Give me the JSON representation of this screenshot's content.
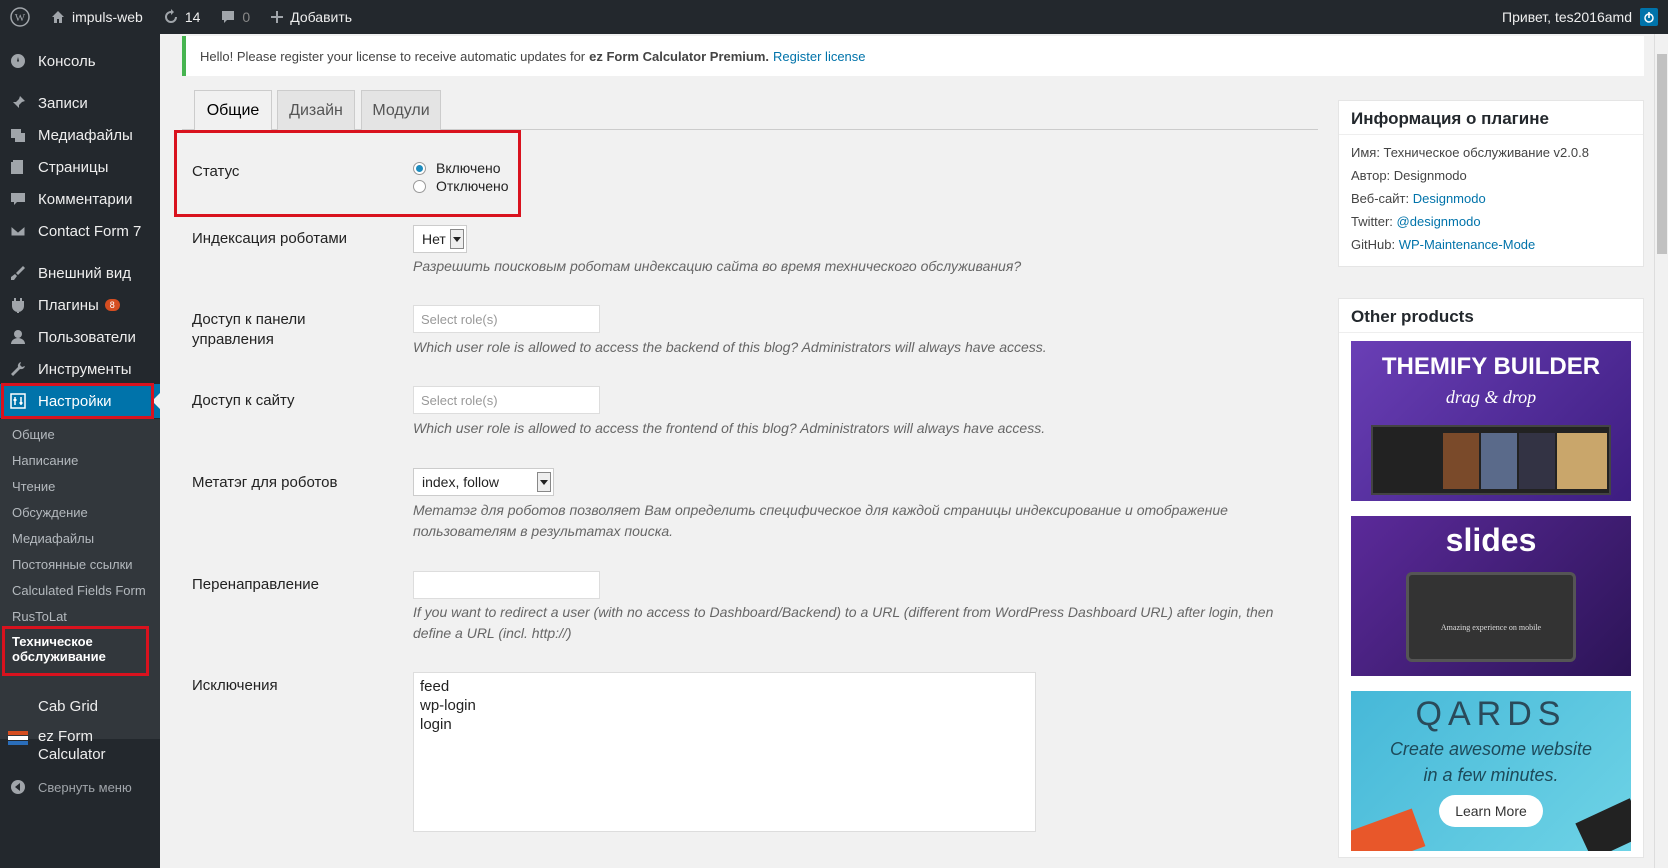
{
  "adminbar": {
    "site_name": "impuls-web",
    "updates_count": "14",
    "comments_count": "0",
    "add_new": "Добавить",
    "greeting": "Привет, tes2016amd"
  },
  "sidebar": {
    "items": [
      {
        "label": "Консоль",
        "icon": "dashboard-icon"
      },
      {
        "label": "Записи",
        "icon": "pin-icon"
      },
      {
        "label": "Медиафайлы",
        "icon": "media-icon"
      },
      {
        "label": "Страницы",
        "icon": "page-icon"
      },
      {
        "label": "Комментарии",
        "icon": "comment-icon"
      },
      {
        "label": "Contact Form 7",
        "icon": "mail-icon"
      },
      {
        "label": "Внешний вид",
        "icon": "brush-icon"
      },
      {
        "label": "Плагины",
        "icon": "plugin-icon",
        "badge": "8"
      },
      {
        "label": "Пользователи",
        "icon": "user-icon"
      },
      {
        "label": "Инструменты",
        "icon": "wrench-icon"
      },
      {
        "label": "Настройки",
        "icon": "settings-icon"
      }
    ],
    "submenu": [
      "Общие",
      "Написание",
      "Чтение",
      "Обсуждение",
      "Медиафайлы",
      "Постоянные ссылки",
      "Calculated Fields Form",
      "RusToLat"
    ],
    "submenu_current_line1": "Техническое",
    "submenu_current_line2": "обслуживание",
    "cab_grid": "Cab Grid",
    "ez_form_line1": "ez Form",
    "ez_form_line2": "Calculator",
    "collapse": "Свернуть меню"
  },
  "notice": {
    "text": "Hello! Please register your license to receive automatic updates for",
    "product": "ez Form Calculator Premium.",
    "link": "Register license"
  },
  "tabs": [
    "Общие",
    "Дизайн",
    "Модули"
  ],
  "form": {
    "status_label": "Статус",
    "status_on": "Включено",
    "status_off": "Отключено",
    "indexing_label": "Индексация роботами",
    "indexing_value": "Нет",
    "indexing_desc": "Разрешить поисковым роботам индексацию сайта во время технического обслуживания?",
    "backend_label_1": "Доступ к панели",
    "backend_label_2": "управления",
    "backend_placeholder": "Select role(s)",
    "backend_desc": "Which user role is allowed to access the backend of this blog? Administrators will always have access.",
    "frontend_label": "Доступ к сайту",
    "frontend_placeholder": "Select role(s)",
    "frontend_desc": "Which user role is allowed to access the frontend of this blog? Administrators will always have access.",
    "meta_label": "Метатэг для роботов",
    "meta_value": "index, follow",
    "meta_desc_1": "Метатэг для роботов позволяет Вам определить специфическое для каждой страницы индексирование и отображение",
    "meta_desc_2": "пользователям в результатах поиска.",
    "redirect_label": "Перенаправление",
    "redirect_desc_1": "If you want to redirect a user (with no access to Dashboard/Backend) to a URL (different from WordPress Dashboard URL) after login, then",
    "redirect_desc_2": "define a URL (incl. http://)",
    "exclusions_label": "Исключения",
    "exclusions": [
      "feed",
      "wp-login",
      "login"
    ]
  },
  "plugin_info": {
    "title": "Информация о плагине",
    "name": "Имя: Техническое обслуживание v2.0.8",
    "author": "Автор: Designmodo",
    "website_label": "Веб-сайт:",
    "website_link": "Designmodo",
    "twitter_label": "Twitter:",
    "twitter_link": "@designmodo",
    "github_label": "GitHub:",
    "github_link": "WP-Maintenance-Mode"
  },
  "other_products": {
    "title": "Other products",
    "p1_title": "THEMIFY BUILDER",
    "p1_sub": "drag & drop",
    "p2_title": "slides",
    "p2_caption": "Amazing experience on mobile",
    "p3_title": "QARDS",
    "p3_line1": "Create awesome website",
    "p3_line2": "in a few minutes.",
    "p3_button": "Learn More"
  },
  "colors": {
    "accent": "#0073aa",
    "adminbar": "#23282d",
    "highlight_border": "#d9121e"
  }
}
